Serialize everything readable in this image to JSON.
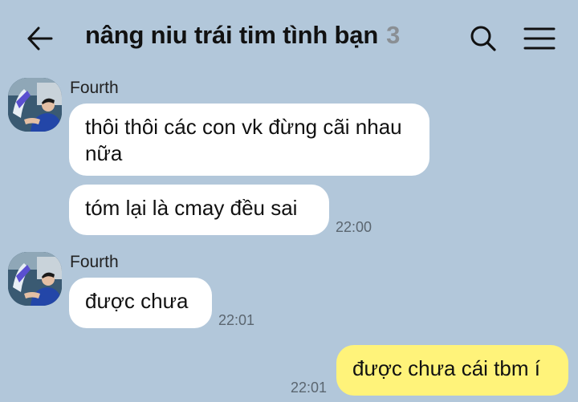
{
  "header": {
    "title": "nâng niu trái tim tình bạn",
    "member_count": "3",
    "back_icon": "arrow-left-icon",
    "search_icon": "search-icon",
    "menu_icon": "hamburger-menu-icon"
  },
  "colors": {
    "background": "#b2c7da",
    "incoming_bubble": "#ffffff",
    "outgoing_bubble": "#fff37a",
    "timestamp": "#5b6670"
  },
  "messages": {
    "group1": {
      "sender": "Fourth",
      "bubble1": "thôi thôi các con vk đừng cãi nhau nữa",
      "bubble2": "tóm lại là cmay đều sai",
      "time": "22:00"
    },
    "group2": {
      "sender": "Fourth",
      "bubble1": "được chưa",
      "time": "22:01"
    },
    "outgoing": {
      "text": "được chưa cái tbm í",
      "time": "22:01"
    }
  }
}
